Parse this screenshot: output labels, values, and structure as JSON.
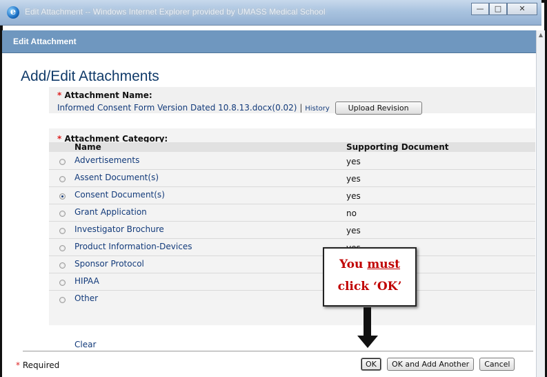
{
  "window": {
    "title": "Edit Attachment -- Windows Internet Explorer provided by UMASS Medical School",
    "min_label": "—",
    "max_label": "□",
    "close_label": "✕"
  },
  "header": {
    "title": "Edit Attachment"
  },
  "page": {
    "title": "Add/Edit Attachments"
  },
  "attachment_name": {
    "required_mark": "*",
    "label": "Attachment Name:",
    "file": "Informed Consent Form Version Dated 10.8.13.docx(0.02)",
    "separator": "|",
    "history_link": "History",
    "upload_button": "Upload Revision"
  },
  "category": {
    "required_mark": "*",
    "label": "Attachment Category:",
    "col_name": "Name",
    "col_supporting": "Supporting Document",
    "rows": [
      {
        "name": "Advertisements",
        "value": "yes",
        "checked": false
      },
      {
        "name": "Assent Document(s)",
        "value": "yes",
        "checked": false
      },
      {
        "name": "Consent Document(s)",
        "value": "yes",
        "checked": true
      },
      {
        "name": "Grant Application",
        "value": "no",
        "checked": false
      },
      {
        "name": "Investigator Brochure",
        "value": "yes",
        "checked": false
      },
      {
        "name": "Product Information-Devices",
        "value": "yes",
        "checked": false
      },
      {
        "name": "Sponsor Protocol",
        "value": "",
        "checked": false
      },
      {
        "name": "HIPAA",
        "value": "",
        "checked": false
      },
      {
        "name": "Other",
        "value": "",
        "checked": false
      }
    ],
    "clear_link": "Clear"
  },
  "footer": {
    "required_mark": "*",
    "required_text": "Required",
    "ok_button": "OK",
    "ok_add_button": "OK and Add Another",
    "cancel_button": "Cancel"
  },
  "callout": {
    "line1_prefix": "You ",
    "line1_emph": "must",
    "line2": "click ‘OK’"
  }
}
